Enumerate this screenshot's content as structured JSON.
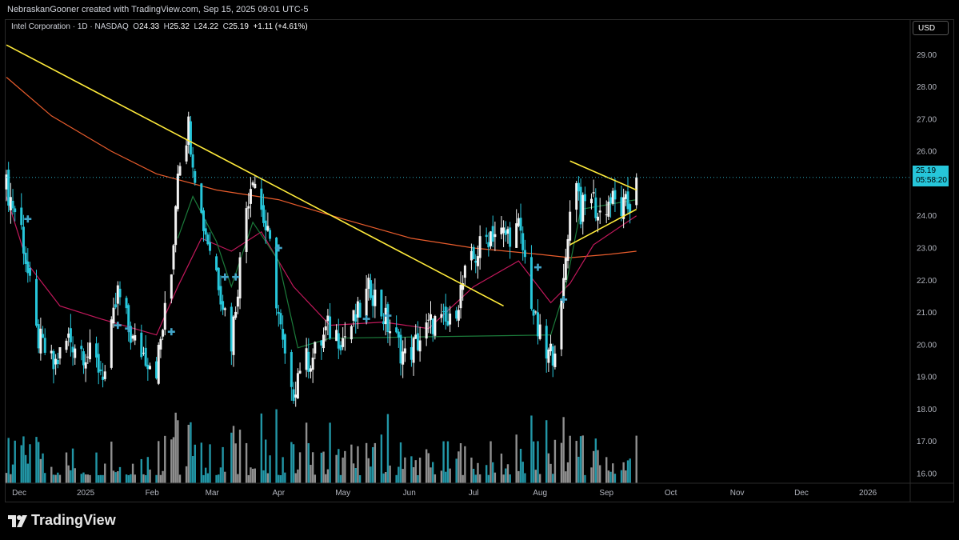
{
  "header": {
    "attribution": "NebraskanGooner created with TradingView.com, Sep 15, 2025 09:01 UTC-5"
  },
  "legend": {
    "symbol": "Intel Corporation · 1D · NASDAQ",
    "open_label": "O",
    "open": "24.33",
    "high_label": "H",
    "high": "25.32",
    "low_label": "L",
    "low": "24.22",
    "close_label": "C",
    "close": "25.19",
    "change": "+1.11 (+4.61%)"
  },
  "currency": "USD",
  "last_price": {
    "price": "25.19",
    "countdown": "05:58:20"
  },
  "footer": {
    "brand": "TradingView"
  },
  "colors": {
    "up": "#f2f2f2",
    "down": "#26c6da",
    "volume": "#26a6b8",
    "trendline": "#ffeb3b",
    "ma_long": "#e85c2c",
    "ma_mid": "#c2185b",
    "ma_short": "#1b7a3a",
    "signal": "#42a5c8"
  },
  "chart_data": {
    "type": "candlestick",
    "title": "Intel Corporation · 1D · NASDAQ",
    "ylim": [
      15.7,
      30.1
    ],
    "y_ticks": [
      "29.00",
      "28.00",
      "27.00",
      "26.00",
      "25.00",
      "24.00",
      "23.00",
      "22.00",
      "21.00",
      "20.00",
      "19.00",
      "18.00",
      "17.00",
      "16.00"
    ],
    "x_ticks": [
      "Dec",
      "2025",
      "Feb",
      "Mar",
      "Apr",
      "May",
      "Jun",
      "Jul",
      "Aug",
      "Sep",
      "Oct",
      "Nov",
      "Dec",
      "2026"
    ],
    "series": [
      {
        "name": "Intel Corporation · 1D · NASDAQ",
        "kind": "price",
        "anchors": [
          {
            "date": "2024-11-25",
            "value": 24.9
          },
          {
            "date": "2024-12-02",
            "value": 23.6
          },
          {
            "date": "2024-12-09",
            "value": 20.3
          },
          {
            "date": "2024-12-17",
            "value": 19.3
          },
          {
            "date": "2024-12-24",
            "value": 20.2
          },
          {
            "date": "2025-01-02",
            "value": 19.7
          },
          {
            "date": "2025-01-10",
            "value": 19.1
          },
          {
            "date": "2025-01-16",
            "value": 21.6
          },
          {
            "date": "2025-01-23",
            "value": 20.1
          },
          {
            "date": "2025-02-03",
            "value": 19.3
          },
          {
            "date": "2025-02-10",
            "value": 22.2
          },
          {
            "date": "2025-02-13",
            "value": 25.6
          },
          {
            "date": "2025-02-18",
            "value": 26.8
          },
          {
            "date": "2025-02-24",
            "value": 24.0
          },
          {
            "date": "2025-03-03",
            "value": 22.3
          },
          {
            "date": "2025-03-10",
            "value": 20.1
          },
          {
            "date": "2025-03-17",
            "value": 24.3
          },
          {
            "date": "2025-03-20",
            "value": 25.4
          },
          {
            "date": "2025-03-28",
            "value": 23.0
          },
          {
            "date": "2025-04-03",
            "value": 19.9
          },
          {
            "date": "2025-04-07",
            "value": 18.3
          },
          {
            "date": "2025-04-11",
            "value": 19.4
          },
          {
            "date": "2025-04-17",
            "value": 19.6
          },
          {
            "date": "2025-04-24",
            "value": 20.5
          },
          {
            "date": "2025-05-01",
            "value": 20.2
          },
          {
            "date": "2025-05-08",
            "value": 20.9
          },
          {
            "date": "2025-05-14",
            "value": 21.8
          },
          {
            "date": "2025-05-22",
            "value": 20.6
          },
          {
            "date": "2025-05-30",
            "value": 19.6
          },
          {
            "date": "2025-06-05",
            "value": 20.1
          },
          {
            "date": "2025-06-12",
            "value": 20.7
          },
          {
            "date": "2025-06-20",
            "value": 20.6
          },
          {
            "date": "2025-06-27",
            "value": 22.1
          },
          {
            "date": "2025-07-03",
            "value": 22.9
          },
          {
            "date": "2025-07-09",
            "value": 23.5
          },
          {
            "date": "2025-07-16",
            "value": 23.4
          },
          {
            "date": "2025-07-22",
            "value": 23.6
          },
          {
            "date": "2025-07-25",
            "value": 22.6
          },
          {
            "date": "2025-07-30",
            "value": 20.6
          },
          {
            "date": "2025-08-04",
            "value": 19.6
          },
          {
            "date": "2025-08-07",
            "value": 19.8
          },
          {
            "date": "2025-08-11",
            "value": 21.0
          },
          {
            "date": "2025-08-14",
            "value": 23.6
          },
          {
            "date": "2025-08-18",
            "value": 25.3
          },
          {
            "date": "2025-08-20",
            "value": 24.1
          },
          {
            "date": "2025-08-25",
            "value": 24.7
          },
          {
            "date": "2025-08-28",
            "value": 24.0
          },
          {
            "date": "2025-09-03",
            "value": 24.5
          },
          {
            "date": "2025-09-08",
            "value": 24.2
          },
          {
            "date": "2025-09-12",
            "value": 24.3
          },
          {
            "date": "2025-09-15",
            "value": 25.19
          }
        ]
      },
      {
        "name": "",
        "kind": "ma_long",
        "points": [
          {
            "date": "2024-11-25",
            "value": 28.3
          },
          {
            "date": "2024-12-16",
            "value": 27.1
          },
          {
            "date": "2025-01-13",
            "value": 26.0
          },
          {
            "date": "2025-02-03",
            "value": 25.3
          },
          {
            "date": "2025-03-03",
            "value": 24.8
          },
          {
            "date": "2025-04-01",
            "value": 24.5
          },
          {
            "date": "2025-05-01",
            "value": 23.9
          },
          {
            "date": "2025-06-02",
            "value": 23.3
          },
          {
            "date": "2025-07-01",
            "value": 23.0
          },
          {
            "date": "2025-08-01",
            "value": 22.8
          },
          {
            "date": "2025-08-15",
            "value": 22.7
          },
          {
            "date": "2025-09-02",
            "value": 22.8
          },
          {
            "date": "2025-09-15",
            "value": 22.9
          }
        ]
      },
      {
        "name": "",
        "kind": "ma_mid",
        "points": [
          {
            "date": "2024-11-25",
            "value": 24.6
          },
          {
            "date": "2024-12-05",
            "value": 22.5
          },
          {
            "date": "2024-12-20",
            "value": 21.2
          },
          {
            "date": "2025-01-08",
            "value": 20.8
          },
          {
            "date": "2025-02-03",
            "value": 20.3
          },
          {
            "date": "2025-02-13",
            "value": 21.8
          },
          {
            "date": "2025-02-24",
            "value": 23.3
          },
          {
            "date": "2025-03-10",
            "value": 22.9
          },
          {
            "date": "2025-03-24",
            "value": 23.5
          },
          {
            "date": "2025-04-08",
            "value": 21.8
          },
          {
            "date": "2025-04-25",
            "value": 20.6
          },
          {
            "date": "2025-05-20",
            "value": 20.7
          },
          {
            "date": "2025-06-10",
            "value": 20.5
          },
          {
            "date": "2025-07-01",
            "value": 21.8
          },
          {
            "date": "2025-07-22",
            "value": 22.6
          },
          {
            "date": "2025-08-06",
            "value": 21.3
          },
          {
            "date": "2025-08-15",
            "value": 21.9
          },
          {
            "date": "2025-08-26",
            "value": 23.1
          },
          {
            "date": "2025-09-15",
            "value": 24.0
          }
        ]
      },
      {
        "name": "",
        "kind": "ma_short",
        "points": [
          {
            "date": "2025-02-13",
            "value": 23.3
          },
          {
            "date": "2025-02-20",
            "value": 24.6
          },
          {
            "date": "2025-03-03",
            "value": 23.2
          },
          {
            "date": "2025-03-10",
            "value": 21.8
          },
          {
            "date": "2025-03-20",
            "value": 23.8
          },
          {
            "date": "2025-04-01",
            "value": 22.6
          },
          {
            "date": "2025-04-10",
            "value": 19.9
          },
          {
            "date": "2025-04-25",
            "value": 20.2
          },
          {
            "date": "2025-08-06",
            "value": 20.3
          },
          {
            "date": "2025-08-13",
            "value": 21.8
          },
          {
            "date": "2025-08-20",
            "value": 24.2
          },
          {
            "date": "2025-09-15",
            "value": 24.5
          }
        ]
      }
    ],
    "trendlines": [
      {
        "from": {
          "date": "2024-11-25",
          "value": 29.3
        },
        "to": {
          "date": "2025-07-15",
          "value": 21.2
        }
      },
      {
        "from": {
          "date": "2025-08-15",
          "value": 25.7
        },
        "to": {
          "date": "2025-09-15",
          "value": 24.8
        }
      },
      {
        "from": {
          "date": "2025-08-15",
          "value": 23.1
        },
        "to": {
          "date": "2025-09-15",
          "value": 24.2
        }
      }
    ],
    "signals": [
      {
        "date": "2024-12-05",
        "value": 23.9
      },
      {
        "date": "2025-01-16",
        "value": 20.6
      },
      {
        "date": "2025-01-21",
        "value": 20.5
      },
      {
        "date": "2025-02-10",
        "value": 20.4
      },
      {
        "date": "2025-03-07",
        "value": 22.1
      },
      {
        "date": "2025-03-12",
        "value": 22.1
      },
      {
        "date": "2025-04-01",
        "value": 23.0
      },
      {
        "date": "2025-05-12",
        "value": 20.8
      },
      {
        "date": "2025-05-22",
        "value": 20.9
      },
      {
        "date": "2025-07-31",
        "value": 22.4
      },
      {
        "date": "2025-08-12",
        "value": 21.4
      }
    ],
    "last_price_line": 25.19,
    "grid": false,
    "volume": "histogram"
  }
}
